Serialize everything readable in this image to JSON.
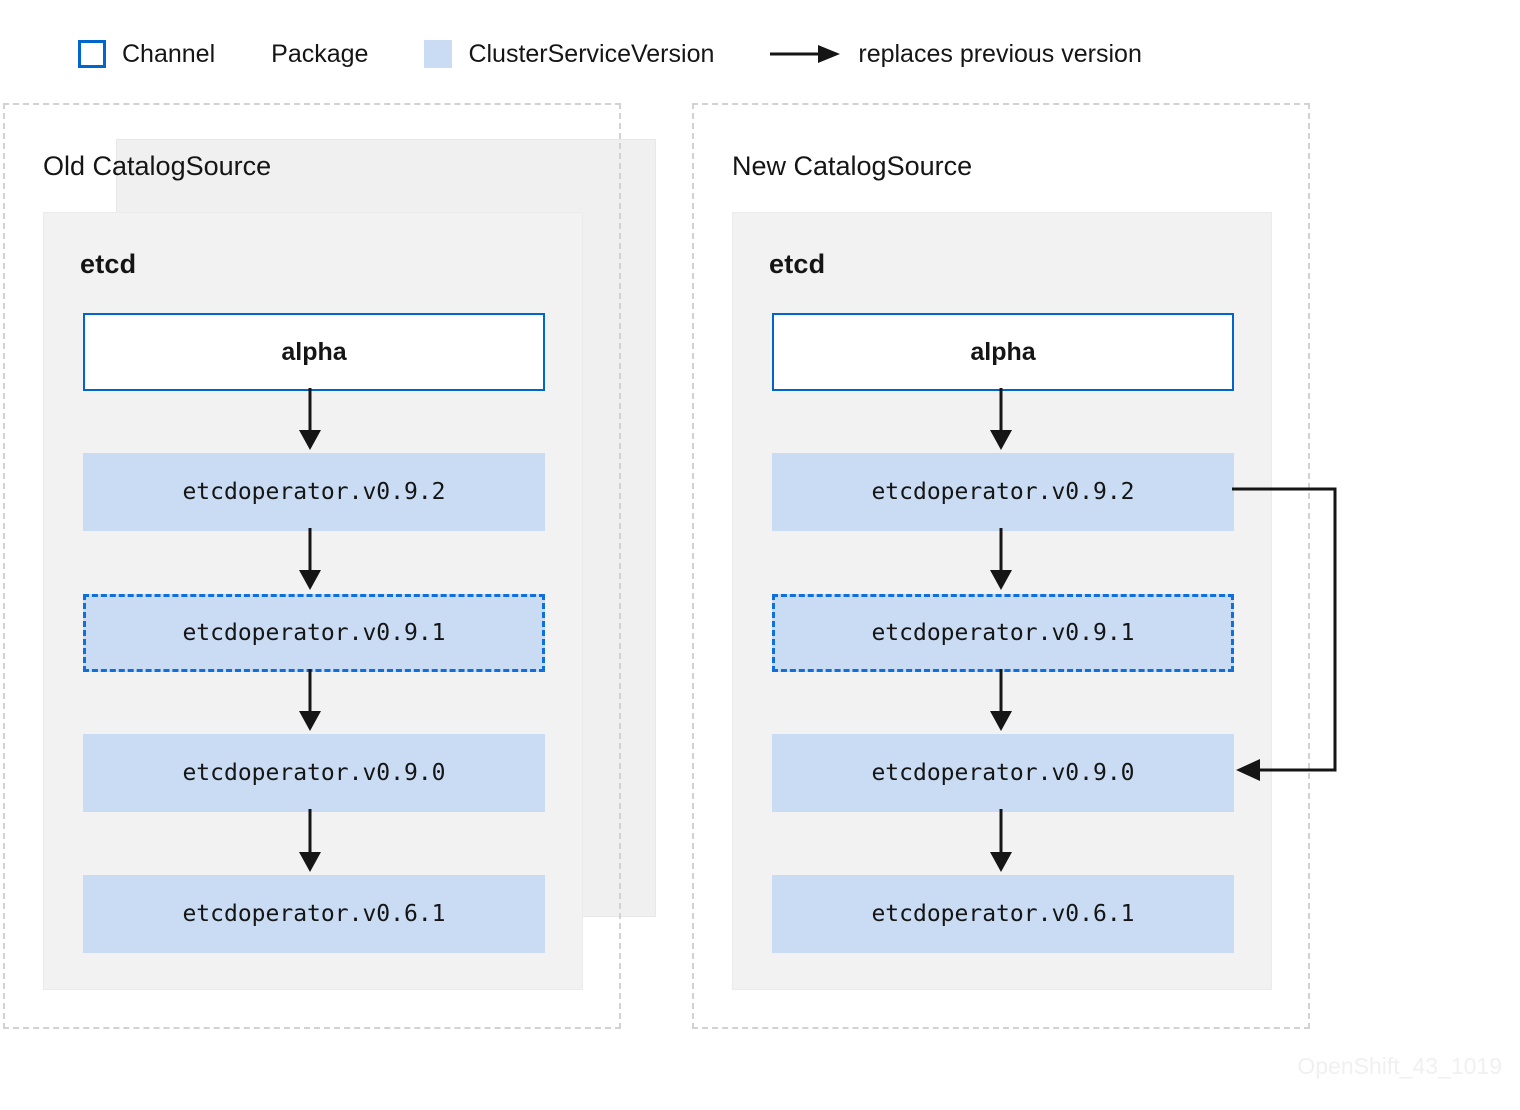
{
  "legend": {
    "items": [
      {
        "swatch": "channel-swatch",
        "label": "Channel"
      },
      {
        "swatch": "package-swatch",
        "label": "Package"
      },
      {
        "swatch": "csv-swatch",
        "label": "ClusterServiceVersion"
      },
      {
        "swatch": "arrow-swatch",
        "label": "replaces previous version"
      }
    ]
  },
  "colors": {
    "channel_border": "#0066cc",
    "package_fill": "#f2f2f2",
    "csv_fill": "#c9dcf3",
    "csv_dashed_border": "#0f6fdb",
    "panel_border": "#d2d2d2",
    "arrow": "#151515",
    "text": "#151515",
    "watermark": "#f0f0f0"
  },
  "panels": [
    {
      "id": "old-catalogsource",
      "title": "Old CatalogSource",
      "package": {
        "name": "etcd",
        "channel": {
          "name": "alpha"
        },
        "csvs": [
          {
            "name": "etcdoperator.v0.9.2",
            "dashed": false
          },
          {
            "name": "etcdoperator.v0.9.1",
            "dashed": true
          },
          {
            "name": "etcdoperator.v0.9.0",
            "dashed": false
          },
          {
            "name": "etcdoperator.v0.6.1",
            "dashed": false
          }
        ]
      }
    },
    {
      "id": "new-catalogsource",
      "title": "New CatalogSource",
      "package": {
        "name": "etcd",
        "channel": {
          "name": "alpha"
        },
        "csvs": [
          {
            "name": "etcdoperator.v0.9.2",
            "dashed": false
          },
          {
            "name": "etcdoperator.v0.9.1",
            "dashed": true
          },
          {
            "name": "etcdoperator.v0.9.0",
            "dashed": false
          },
          {
            "name": "etcdoperator.v0.6.1",
            "dashed": false
          }
        ]
      }
    }
  ],
  "skip_arrow": {
    "from": "etcdoperator.v0.9.2",
    "to": "etcdoperator.v0.9.0",
    "meaning": "replaces previous version"
  },
  "watermark": "OpenShift_43_1019"
}
